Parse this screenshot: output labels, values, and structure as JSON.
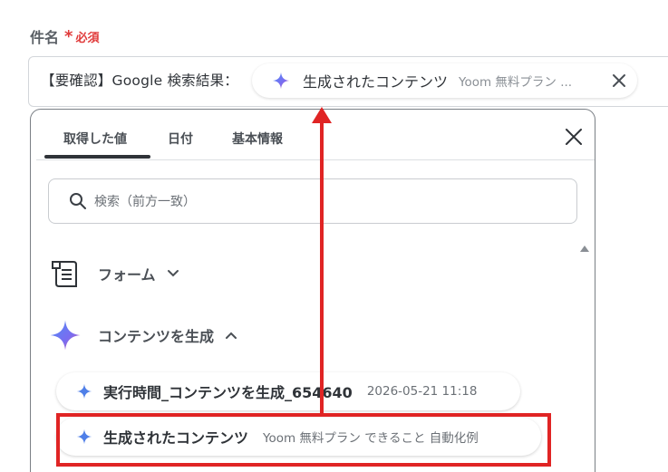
{
  "field": {
    "label": "件名",
    "required_star": "*",
    "required_text": "必須",
    "prefix_text": "【要確認】Google 検索結果："
  },
  "chip": {
    "title": "生成されたコンテンツ",
    "subtitle": "Yoom 無料プラン ...",
    "icon": "sparkle-icon"
  },
  "dropdown": {
    "tabs": [
      {
        "label": "取得した値",
        "active": true
      },
      {
        "label": "日付",
        "active": false
      },
      {
        "label": "基本情報",
        "active": false
      }
    ],
    "search_placeholder": "検索（前方一致）",
    "sections": [
      {
        "label": "フォーム",
        "icon": "form-icon",
        "expanded": false
      },
      {
        "label": "コンテンツを生成",
        "icon": "sparkle-icon",
        "expanded": true
      }
    ],
    "items": [
      {
        "title": "実行時間_コンテンツを生成_654640",
        "subtitle": "2026-05-21 11:18"
      },
      {
        "title": "生成されたコンテンツ",
        "subtitle": "Yoom 無料プラン できること 自動化例"
      }
    ]
  },
  "colors": {
    "accent_red": "#e02424",
    "text": "#2f3338"
  }
}
